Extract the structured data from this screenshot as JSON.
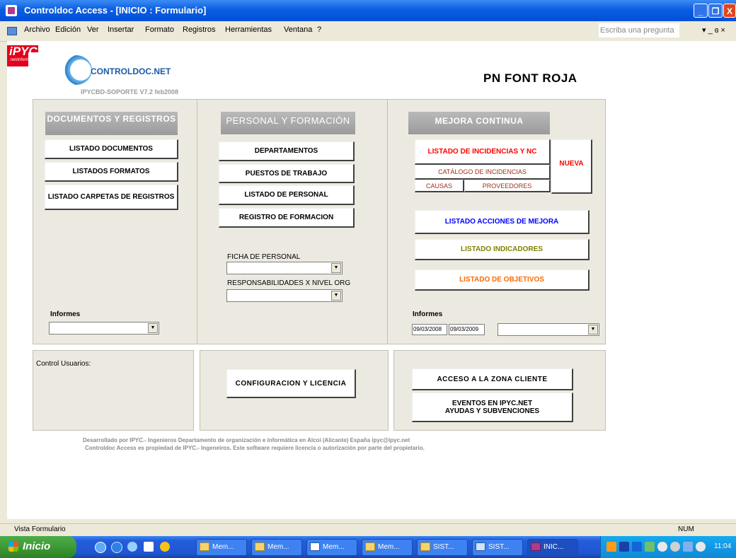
{
  "window": {
    "title": "Controldoc Access - [INICIO : Formulario]",
    "buttons": [
      "_",
      "❐",
      "X"
    ]
  },
  "menu": {
    "items": [
      "Archivo",
      "Edición",
      "Ver",
      "Insertar",
      "Formato",
      "Registros",
      "Herramientas",
      "Ventana",
      "?"
    ],
    "ask_placeholder": "Escriba una pregunta",
    "right_controls": "▾ _ ɞ ×"
  },
  "header": {
    "ipyc_logo": "iPYC",
    "ipyc_sub": ".net/informática",
    "controldoc_logo": "CONTROLDOC.NET",
    "version": "IPYCBD-SOPORTE V7.2 feb2008",
    "company": "PN FONT ROJA"
  },
  "documents": {
    "title": "DOCUMENTOS Y REGISTROS",
    "buttons": [
      "LISTADO DOCUMENTOS",
      "LISTADOS FORMATOS",
      "LISTADO CARPETAS DE REGISTROS"
    ],
    "informes_label": "Informes",
    "informes_value": ""
  },
  "personal": {
    "title": "PERSONAL Y FORMACIÓN",
    "buttons": [
      "DEPARTAMENTOS",
      "PUESTOS DE TRABAJO",
      "LISTADO DE PERSONAL",
      "REGISTRO DE FORMACION"
    ],
    "ficha_label": "FICHA DE PERSONAL",
    "resp_label": "RESPONSABILIDADES X NIVEL ORG"
  },
  "mejora": {
    "title": "MEJORA CONTINUA",
    "incidencias": "LISTADO DE INCIDENCIAS Y NC",
    "catalogo": "CATÁLOGO DE INCIDENCIAS",
    "causas": "CAUSAS",
    "proveedores": "PROVEEDORES",
    "nueva": "NUEVA",
    "acciones": "LISTADO ACCIONES DE MEJORA",
    "indicadores": "LISTADO INDICADORES",
    "objetivos": "LISTADO DE OBJETIVOS",
    "informes_label": "Informes",
    "date_from": "09/03/2008",
    "date_to": "09/03/2009"
  },
  "bottom": {
    "control_usuarios": "Control Usuarios:",
    "configuracion": "CONFIGURACION Y LICENCIA",
    "acceso": "ACCESO A LA ZONA CLIENTE",
    "eventos": "EVENTOS EN IPYC.NET AYUDAS Y SUBVENCIONES"
  },
  "footer": {
    "line1": "Desarrollado por IPYC.- Ingenieros    Departamento de organización e informática   en Alcoi (Alicante) España   ipyc@ipyc.net",
    "line2": "Controldoc Access es propiedad de IPYC.- Ingeneiros. Este software requiere licencia o autorización por parte del propietario."
  },
  "status": {
    "left": "Vista Formulario",
    "right": "NUM"
  },
  "taskbar": {
    "start": "Inicio",
    "tasks": [
      "Mem...",
      "Mem...",
      "Mem...",
      "Mem...",
      "SIST...",
      "SIST...",
      "INIC..."
    ],
    "clock": "11:04"
  },
  "colors": {
    "incidencias": "#ff0000",
    "nueva": "#ff0000",
    "catalogo": "#a0301a",
    "acciones": "#0000ff",
    "indicadores": "#808000",
    "objetivos": "#ff6a00",
    "logo_blue": "#1a5aa8"
  }
}
